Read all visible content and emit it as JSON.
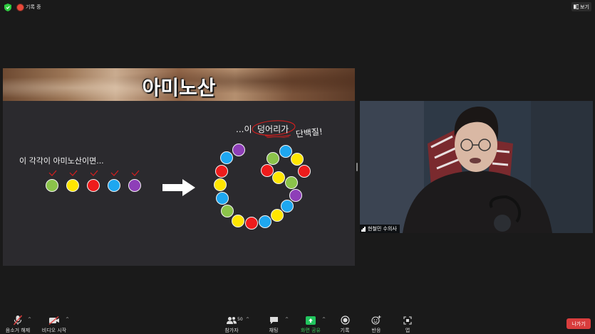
{
  "topbar": {
    "recording_label": "기록 중",
    "view_label": "보기"
  },
  "slide": {
    "title": "아미노산",
    "caption": "이 각각이 아미노산이면...",
    "slogan_pre": "...이",
    "slogan_mid": "덩어리가",
    "slogan_post": "단백질!"
  },
  "colors": {
    "green": "#8bc34a",
    "yellow": "#ffe600",
    "red": "#ee1c1c",
    "blue": "#1ea7f0",
    "purple": "#8e3fb8"
  },
  "webcam": {
    "name": "현철민 수의사"
  },
  "toolbar": {
    "mute": "음소거 해제",
    "video": "비디오 시작",
    "participants": "참가자",
    "participants_count": "50",
    "chat": "채팅",
    "share": "화면 공유",
    "record": "기록",
    "reactions": "반응",
    "apps": "앱",
    "leave": "나가기"
  }
}
